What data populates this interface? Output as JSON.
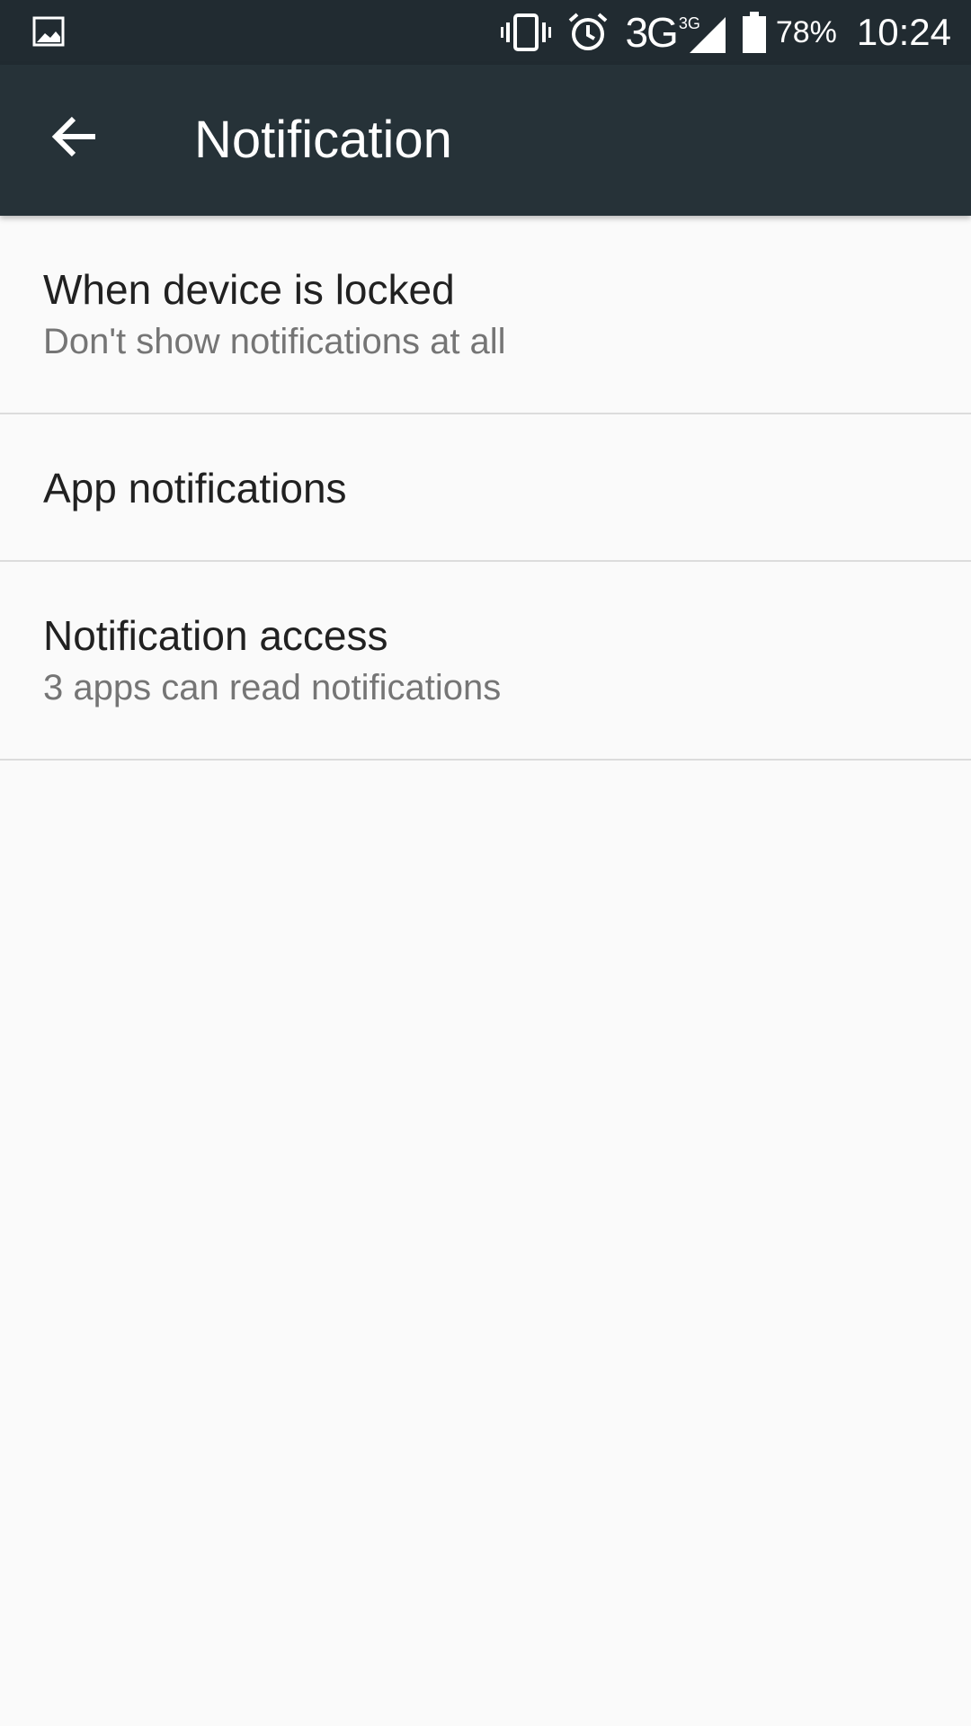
{
  "status_bar": {
    "icons": [
      "gallery-icon",
      "vibrate-icon",
      "alarm-icon",
      "signal-icon",
      "battery-icon"
    ],
    "network_type": "3G",
    "network_badge": "3G",
    "battery_percent": "78%",
    "time": "10:24"
  },
  "toolbar": {
    "back_icon": "arrow-back-icon",
    "title": "Notification",
    "background": "#263238"
  },
  "settings": {
    "items": [
      {
        "title": "When device is locked",
        "subtitle": "Don't show notifications at all"
      },
      {
        "title": "App notifications"
      },
      {
        "title": "Notification access",
        "subtitle": "3 apps can read notifications"
      }
    ]
  }
}
